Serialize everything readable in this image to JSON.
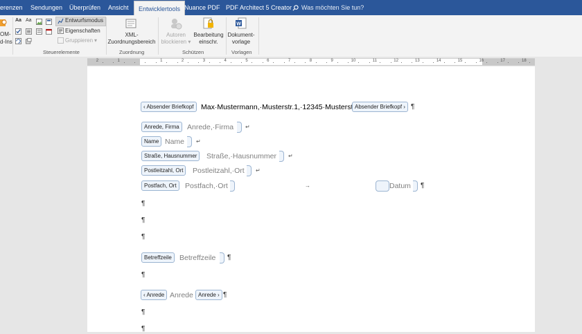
{
  "tabs": [
    "erenzen",
    "Sendungen",
    "Überprüfen",
    "Ansicht",
    "Entwicklertools",
    "Nuance PDF",
    "PDF Architect 5 Creator"
  ],
  "search_placeholder": "Was möchten Sie tun?",
  "ribbon": {
    "addins_label_1": "OM-",
    "addins_label_2": "d-Ins",
    "design_mode": "Entwurfsmodus",
    "properties": "Eigenschaften",
    "group_btn": "Gruppieren",
    "controls_group": "Steuerelemente",
    "xml_line1": "XML-",
    "xml_line2": "Zuordnungsbereich",
    "mapping_group": "Zuordnung",
    "block_line1": "Autoren",
    "block_line2": "blockieren",
    "restrict_line1": "Bearbeitung",
    "restrict_line2": "einschr.",
    "protect_group": "Schützen",
    "template_line1": "Dokument-",
    "template_line2": "vorlage",
    "templates_group": "Vorlagen"
  },
  "ruler_numbers": [
    "2",
    "1",
    "1",
    "2",
    "3",
    "4",
    "5",
    "6",
    "7",
    "8",
    "9",
    "10",
    "11",
    "12",
    "13",
    "14",
    "15",
    "16",
    "17",
    "18"
  ],
  "document": {
    "sender_tag": "Absender Briefkopf",
    "sender_text": "Max·Mustermann,·Musterstr.1,·12345·Musterstadt",
    "salutation_company_tag": "Anrede, Firma",
    "salutation_company_ph": "Anrede,·Firma",
    "name_tag": "Name",
    "name_ph": "Name",
    "street_tag": "Straße, Hausnummer",
    "street_ph": "Straße,·Hausnummer",
    "zip_tag": "Postleitzahl, Ort",
    "zip_ph": "Postleitzahl,·Ort",
    "pobox_tag": "Postfach, Ort",
    "pobox_ph": "Postfach,·Ort",
    "date_ph": "Datum",
    "subject_tag": "Betreffzeile",
    "subject_ph": "Betreffzeile",
    "salutation_tag": "Anrede",
    "salutation_ph": "Anrede",
    "pilcrow": "¶",
    "linebreak": "↵",
    "tab_arrow": "→"
  }
}
